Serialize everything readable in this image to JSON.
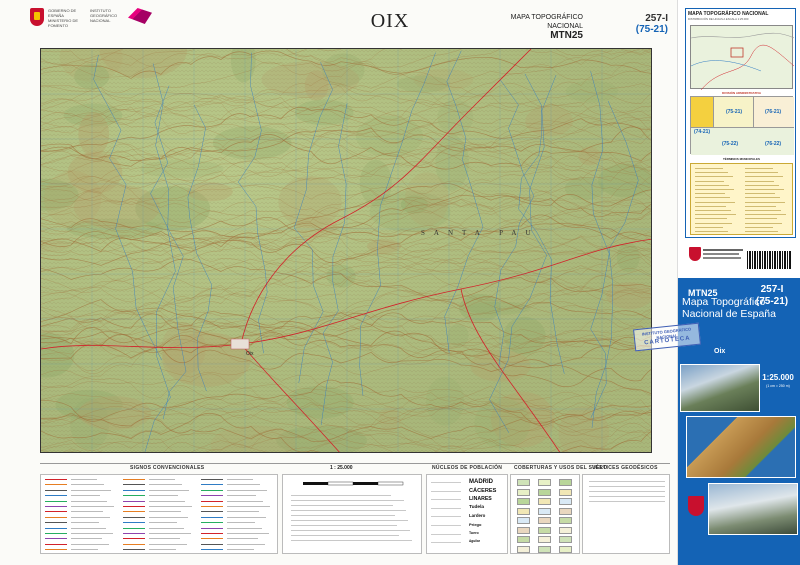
{
  "header": {
    "title": "OIX",
    "logo_line1": "GOBIERNO DE ESPAÑA",
    "logo_line2": "MINISTERIO DE FOMENTO",
    "logo_line3": "INSTITUTO GEOGRÁFICO NACIONAL",
    "mtn_line1": "MAPA TOPOGRÁFICO NACIONAL",
    "mtn_line2": "MTN25",
    "sheet_number": "257-I",
    "sheet_grid": "(75-21)"
  },
  "map": {
    "place_labels": [
      "Oix",
      "SANTA PAU"
    ],
    "colors": {
      "relief_base": "#c7d39e",
      "contour": "#a0703a",
      "river": "#2f7cc4",
      "road": "#d2222a",
      "urban": "#e8e0d8"
    }
  },
  "legend": {
    "signos_title": "SIGNOS CONVENCIONALES",
    "scale_title": "1 : 25.000",
    "nucleos_title": "NÚCLEOS DE POBLACIÓN",
    "coberturas_title": "COBERTURAS Y USOS DEL SUELO",
    "vertices_title": "VÉRTICES GEODÉSICOS",
    "nucleos_words": [
      "MADRID",
      "CÁCERES",
      "LINARES",
      "Tudela",
      "Lardero",
      "Priego",
      "Tuero",
      "Aguilar"
    ],
    "publisher": "INSTITUTO GEOGRÁFICO NACIONAL"
  },
  "cover": {
    "index_title": "MAPA TOPOGRÁFICO NACIONAL",
    "index_subtitle": "DISTRIBUCIÓN DE HOJAS A ESCALA 1:25.000",
    "admin_title": "DIVISIÓN ADMINISTRATIVA",
    "admin_cells": [
      "(74-21)",
      "(75-21)",
      "(76-21)",
      "(75-22)",
      "(76-22)"
    ],
    "terminos_title": "TÉRMINOS MUNICIPALES",
    "mtn": "MTN25",
    "number": "257-I",
    "grid": "(75-21)",
    "big_title": "Mapa Topográfico Nacional de España",
    "place": "Oix",
    "scale": "1:25.000",
    "scale_sub": "(1 cm = 250 m)"
  },
  "stamp": {
    "line1": "INSTITUTO GEOGRÁFICO",
    "line2": "NACIONAL",
    "line3": "CARTOTECA"
  }
}
